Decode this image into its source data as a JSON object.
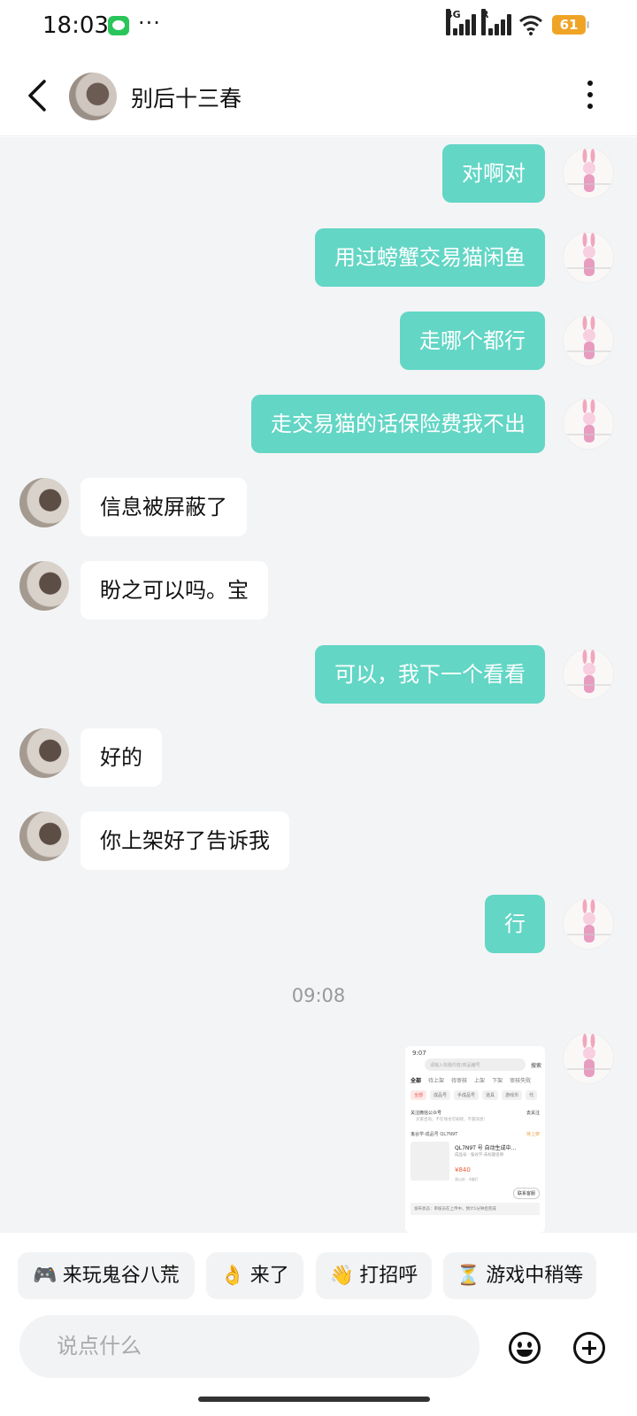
{
  "status_bar": {
    "time": "18:03",
    "dots": "···",
    "network1": "4G",
    "network2": "R",
    "battery": "61"
  },
  "header": {
    "title": "别后十三春"
  },
  "messages": [
    {
      "side": "me",
      "text": "对啊对"
    },
    {
      "side": "me",
      "text": "用过螃蟹交易猫闲鱼"
    },
    {
      "side": "me",
      "text": "走哪个都行"
    },
    {
      "side": "me",
      "text": "走交易猫的话保险费我不出"
    },
    {
      "side": "them",
      "text": "信息被屏蔽了"
    },
    {
      "side": "them",
      "text": "盼之可以吗。宝"
    },
    {
      "side": "me",
      "text": "可以，我下一个看看"
    },
    {
      "side": "them",
      "text": "好的"
    },
    {
      "side": "them",
      "text": "你上架好了告诉我"
    },
    {
      "side": "me",
      "text": "行"
    }
  ],
  "timestamp": "09:08",
  "shared_screenshot": {
    "time": "9:07",
    "search_placeholder": "请输入标题内容/商品编号",
    "search_button": "搜索",
    "tabs": [
      "全部",
      "待上架",
      "待审核",
      "上架",
      "下架",
      "审核失败"
    ],
    "chips": [
      "全部",
      "成品号",
      "手成品号",
      "道具",
      "游戏币",
      "代"
    ],
    "follow_notice": "关注微信公众号",
    "follow_button": "去关注",
    "follow_sub": "买家咨询，不在线也可知晓，不漏消息！",
    "listing_line": "鬼谷学-成品号 QL7N9T",
    "listing_status": "待上架",
    "item_title": "QL7N9T 号 自动生成中...",
    "item_sub": "成品号 · 鬼谷学-未标题名称",
    "item_price": "¥840",
    "item_meta": "表以折 · 4佛们",
    "contact_button": "联系客服",
    "footer_note": "发布状态：审核员在上传中，预计1分钟后完成"
  },
  "quick_replies": [
    {
      "emoji": "🎮",
      "label": "来玩鬼谷八荒"
    },
    {
      "emoji": "👌",
      "label": "来了"
    },
    {
      "emoji": "👋",
      "label": "打招呼"
    },
    {
      "emoji": "⏳",
      "label": "游戏中稍等"
    }
  ],
  "input": {
    "placeholder": "说点什么"
  }
}
